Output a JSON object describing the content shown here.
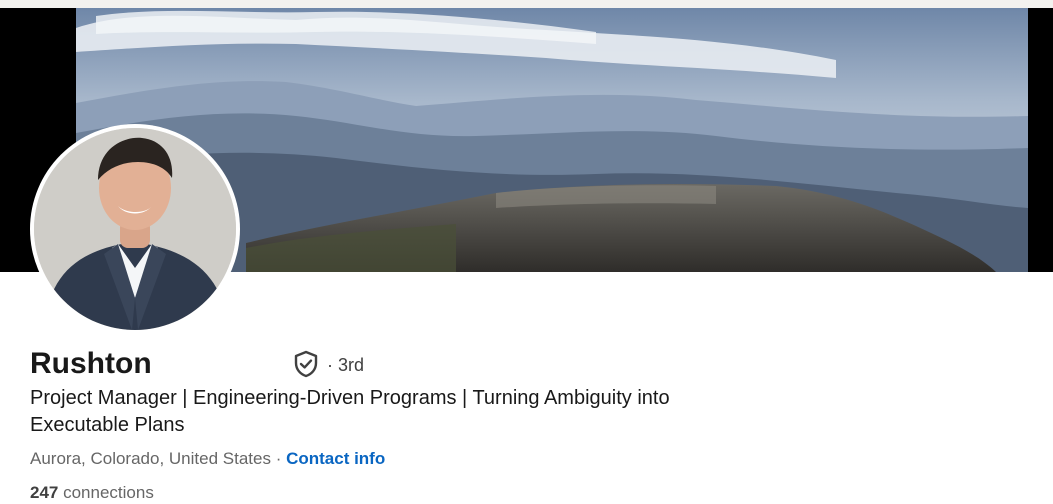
{
  "profile": {
    "name": "Rushton",
    "degree": "· 3rd",
    "headline": "Project Manager | Engineering-Driven Programs | Turning Ambiguity into Executable Plans",
    "location": "Aurora, Colorado, United States",
    "separator": " · ",
    "contact_info_label": "Contact info",
    "connections_count": "247",
    "connections_label": " connections"
  },
  "icons": {
    "verification": "shield-check-icon"
  },
  "colors": {
    "link": "#0a66c2",
    "text_primary": "#191919",
    "text_secondary": "#666666"
  }
}
